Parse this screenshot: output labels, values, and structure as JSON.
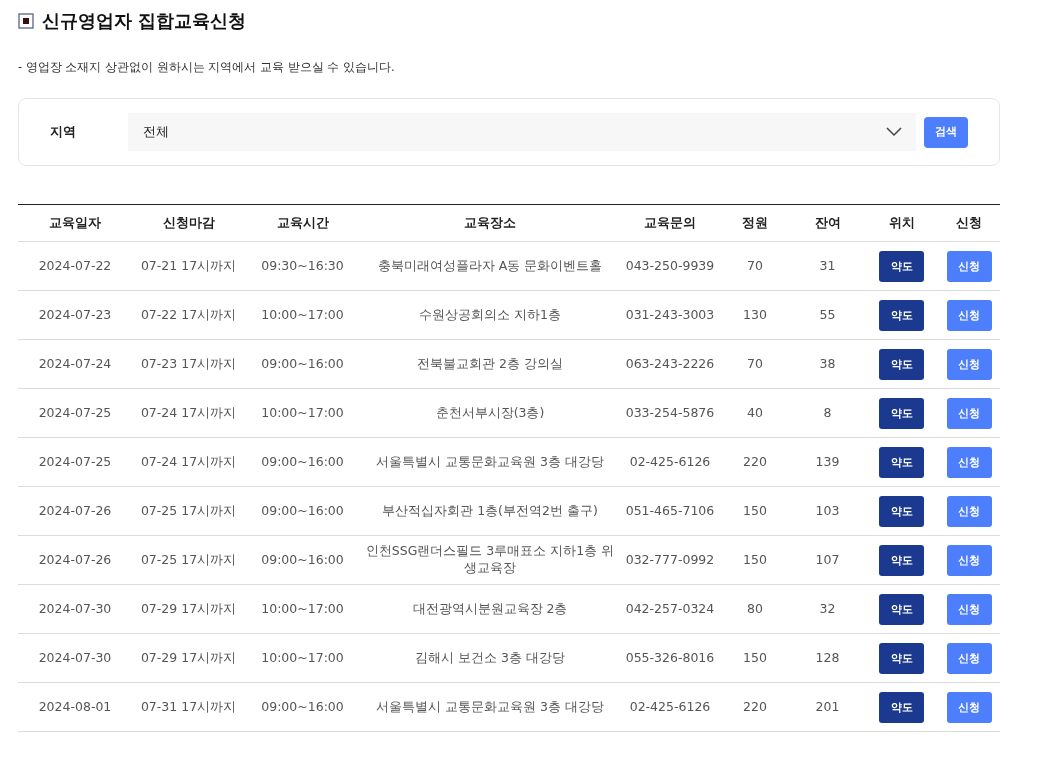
{
  "title": "신규영업자 집합교육신청",
  "notice": "- 영업장 소재지 상관없이 원하시는 지역에서 교육 받으실 수 있습니다.",
  "filter": {
    "label": "지역",
    "value": "전체",
    "search_button": "검색"
  },
  "table": {
    "columns": [
      "교육일자",
      "신청마감",
      "교육시간",
      "교육장소",
      "교육문의",
      "정원",
      "잔여",
      "위치",
      "신청"
    ],
    "rows": [
      {
        "date": "2024-07-22",
        "deadline": "07-21 17시까지",
        "time": "09:30~16:30",
        "place": "충북미래여성플라자 A동 문화이벤트홀",
        "contact": "043-250-9939",
        "capacity": "70",
        "remaining": "31",
        "map_button": "약도",
        "apply_button": "신청"
      },
      {
        "date": "2024-07-23",
        "deadline": "07-22 17시까지",
        "time": "10:00~17:00",
        "place": "수원상공회의소 지하1층",
        "contact": "031-243-3003",
        "capacity": "130",
        "remaining": "55",
        "map_button": "약도",
        "apply_button": "신청"
      },
      {
        "date": "2024-07-24",
        "deadline": "07-23 17시까지",
        "time": "09:00~16:00",
        "place": "전북불교회관 2층 강의실",
        "contact": "063-243-2226",
        "capacity": "70",
        "remaining": "38",
        "map_button": "약도",
        "apply_button": "신청"
      },
      {
        "date": "2024-07-25",
        "deadline": "07-24 17시까지",
        "time": "10:00~17:00",
        "place": "춘천서부시장(3층)",
        "contact": "033-254-5876",
        "capacity": "40",
        "remaining": "8",
        "map_button": "약도",
        "apply_button": "신청"
      },
      {
        "date": "2024-07-25",
        "deadline": "07-24 17시까지",
        "time": "09:00~16:00",
        "place": "서울특별시 교통문화교육원 3층 대강당",
        "contact": "02-425-6126",
        "capacity": "220",
        "remaining": "139",
        "map_button": "약도",
        "apply_button": "신청"
      },
      {
        "date": "2024-07-26",
        "deadline": "07-25 17시까지",
        "time": "09:00~16:00",
        "place": "부산적십자회관 1층(부전역2번 출구)",
        "contact": "051-465-7106",
        "capacity": "150",
        "remaining": "103",
        "map_button": "약도",
        "apply_button": "신청"
      },
      {
        "date": "2024-07-26",
        "deadline": "07-25 17시까지",
        "time": "09:00~16:00",
        "place": "인천SSG랜더스필드 3루매표소 지하1층 위생교육장",
        "contact": "032-777-0992",
        "capacity": "150",
        "remaining": "107",
        "map_button": "약도",
        "apply_button": "신청"
      },
      {
        "date": "2024-07-30",
        "deadline": "07-29 17시까지",
        "time": "10:00~17:00",
        "place": "대전광역시분원교육장 2층",
        "contact": "042-257-0324",
        "capacity": "80",
        "remaining": "32",
        "map_button": "약도",
        "apply_button": "신청"
      },
      {
        "date": "2024-07-30",
        "deadline": "07-29 17시까지",
        "time": "10:00~17:00",
        "place": "김해시 보건소 3층 대강당",
        "contact": "055-326-8016",
        "capacity": "150",
        "remaining": "128",
        "map_button": "약도",
        "apply_button": "신청"
      },
      {
        "date": "2024-08-01",
        "deadline": "07-31 17시까지",
        "time": "09:00~16:00",
        "place": "서울특별시 교통문화교육원 3층 대강당",
        "contact": "02-425-6126",
        "capacity": "220",
        "remaining": "201",
        "map_button": "약도",
        "apply_button": "신청"
      }
    ]
  }
}
